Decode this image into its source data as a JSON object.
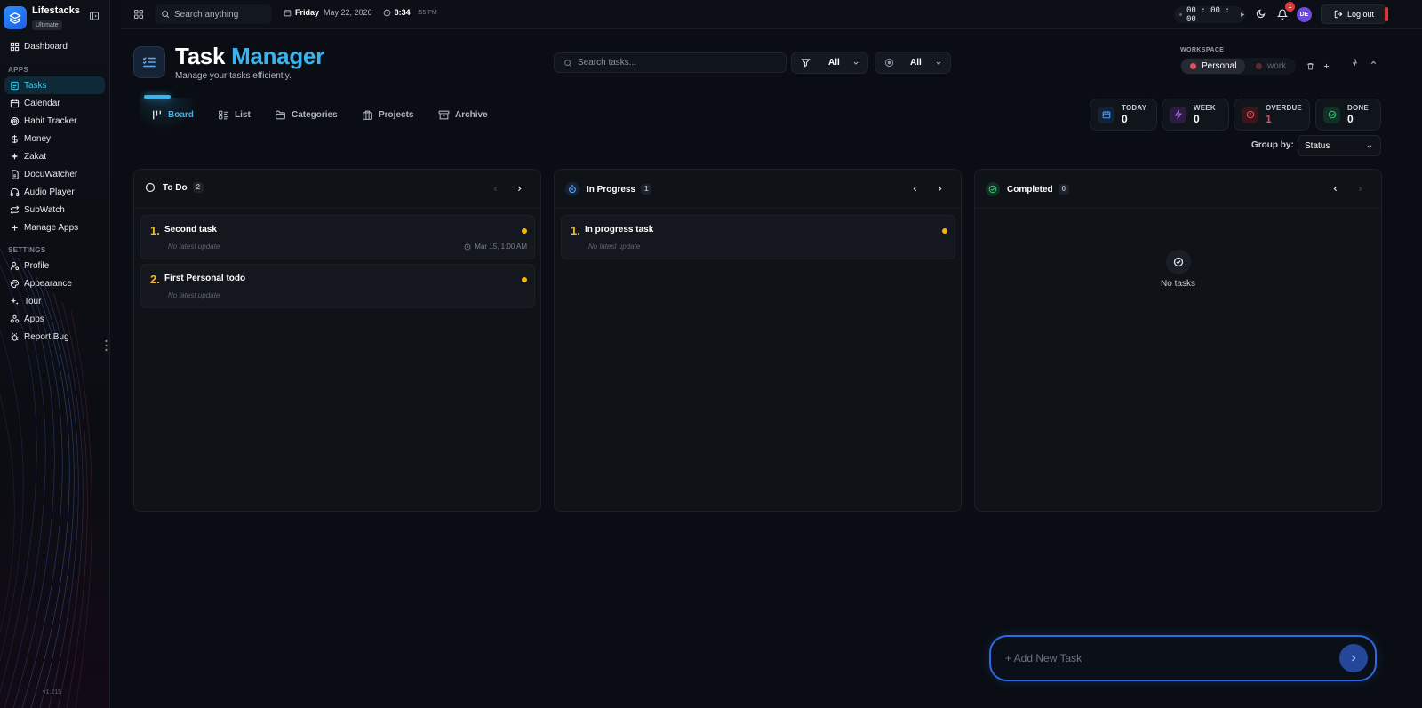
{
  "app": {
    "name": "Lifestacks",
    "plan": "Ultimate",
    "version": "v1.215",
    "colors": {
      "accent": "#39b4f1",
      "brand": "#2b8dff",
      "danger": "#e5333a",
      "priority": "#f5b50f"
    }
  },
  "sidebar": {
    "dashboard": "Dashboard",
    "apps_label": "APPS",
    "apps": [
      {
        "label": "Tasks",
        "icon": "checklist-icon",
        "active": true
      },
      {
        "label": "Calendar",
        "icon": "calendar-icon"
      },
      {
        "label": "Habit Tracker",
        "icon": "target-icon"
      },
      {
        "label": "Money",
        "icon": "dollar-icon"
      },
      {
        "label": "Zakat",
        "icon": "sparkle-icon"
      },
      {
        "label": "DocuWatcher",
        "icon": "document-icon"
      },
      {
        "label": "Audio Player",
        "icon": "headphones-icon"
      },
      {
        "label": "SubWatch",
        "icon": "repeat-icon"
      },
      {
        "label": "Manage Apps",
        "icon": "plus-icon"
      }
    ],
    "settings_label": "SETTINGS",
    "settings": [
      {
        "label": "Profile",
        "icon": "user-cog-icon"
      },
      {
        "label": "Appearance",
        "icon": "palette-icon"
      },
      {
        "label": "Tour",
        "icon": "sparkles-icon"
      },
      {
        "label": "Apps",
        "icon": "blocks-icon"
      },
      {
        "label": "Report Bug",
        "icon": "bug-icon"
      }
    ]
  },
  "topbar": {
    "search_placeholder": "Search anything",
    "day": "Friday",
    "date": "May 22, 2026",
    "time": "8:34",
    "seconds": ":55 PM",
    "timer": "00 : 00 : 00",
    "notifications": "1",
    "avatar": "DE",
    "logout": "Log out"
  },
  "header": {
    "title_main": "Task",
    "title_accent": "Manager",
    "subtitle": "Manage your tasks efficiently.",
    "search_placeholder": "Search tasks...",
    "filter_value": "All",
    "priority_value": "All",
    "workspace_label": "WORKSPACE",
    "workspace_personal": "Personal",
    "workspace_work": "work"
  },
  "tabs": [
    "Board",
    "List",
    "Categories",
    "Projects",
    "Archive"
  ],
  "stats": [
    {
      "label": "TODAY",
      "value": "0"
    },
    {
      "label": "WEEK",
      "value": "0"
    },
    {
      "label": "OVERDUE",
      "value": "1"
    },
    {
      "label": "DONE",
      "value": "0"
    }
  ],
  "group_by": {
    "label": "Group by:",
    "value": "Status"
  },
  "columns": [
    {
      "title": "To Do",
      "count": "2",
      "tasks": [
        {
          "num": "1.",
          "title": "Second task",
          "sub": "No latest update",
          "date": "Mar 15, 1:00 AM"
        },
        {
          "num": "2.",
          "title": "First Personal todo",
          "sub": "No latest update"
        }
      ]
    },
    {
      "title": "In Progress",
      "count": "1",
      "tasks": [
        {
          "num": "1.",
          "title": "In progress task",
          "sub": "No latest update"
        }
      ]
    },
    {
      "title": "Completed",
      "count": "0",
      "empty": "No tasks"
    }
  ],
  "add_task": {
    "placeholder": "+ Add New Task"
  }
}
